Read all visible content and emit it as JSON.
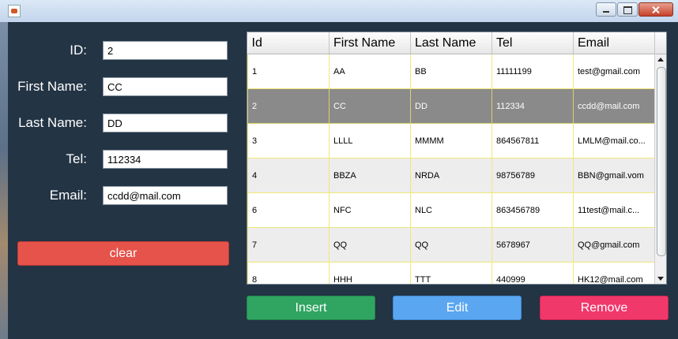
{
  "window": {
    "title": ""
  },
  "form": {
    "id_label": "ID:",
    "id_value": "2",
    "first_name_label": "First Name:",
    "first_name_value": "CC",
    "last_name_label": "Last Name:",
    "last_name_value": "DD",
    "tel_label": "Tel:",
    "tel_value": "112334",
    "email_label": "Email:",
    "email_value": "ccdd@mail.com"
  },
  "buttons": {
    "clear": "clear",
    "insert": "Insert",
    "edit": "Edit",
    "remove": "Remove"
  },
  "table": {
    "headers": [
      "Id",
      "First Name",
      "Last Name",
      "Tel",
      "Email"
    ],
    "rows": [
      [
        "1",
        "AA",
        "BB",
        "11111199",
        "test@gmail.com"
      ],
      [
        "2",
        "CC",
        "DD",
        "112334",
        "ccdd@mail.com"
      ],
      [
        "3",
        "LLLL",
        "MMMM",
        "864567811",
        "LMLM@mail.co..."
      ],
      [
        "4",
        "BBZA",
        "NRDA",
        "98756789",
        "BBN@gmail.vom"
      ],
      [
        "6",
        "NFC",
        "NLC",
        "863456789",
        "11test@mail.c..."
      ],
      [
        "7",
        "QQ",
        "QQ",
        "5678967",
        "QQ@gmail.com"
      ],
      [
        "8",
        "HHH",
        "TTT",
        "440999",
        "HK12@mail.com"
      ]
    ],
    "selected_row_index": 1
  },
  "colors": {
    "background": "#233444",
    "clear": "#e5534b",
    "insert": "#2fa561",
    "edit": "#5aa6f0",
    "remove": "#f1386b",
    "selected_row": "#8a8a8a"
  }
}
